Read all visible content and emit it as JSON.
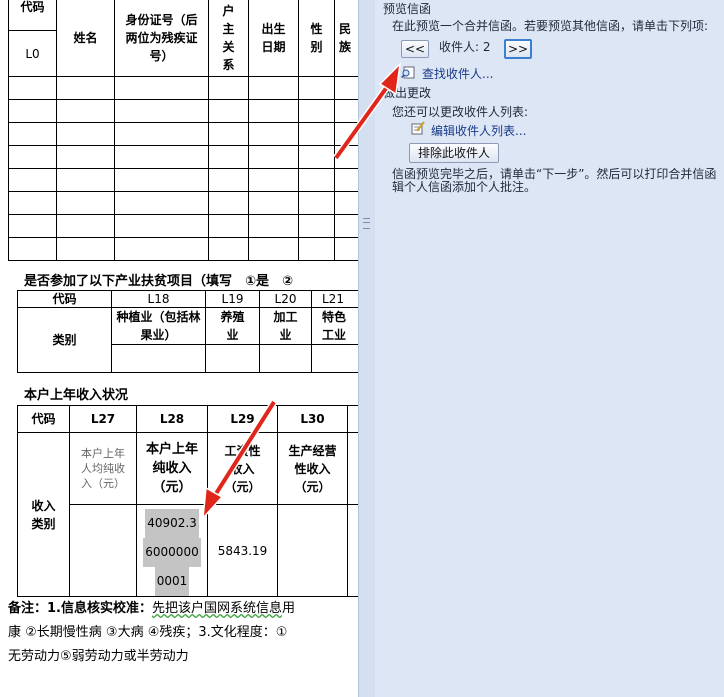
{
  "table1": {
    "headers": {
      "code": "代码",
      "name": "姓名",
      "id": "身份证号（后两位为残疾证号）",
      "relation": "户主关系",
      "birth": "出生日期",
      "gender": "性别",
      "ethnic": "民族"
    },
    "row_code": "L0"
  },
  "section2": {
    "title": "是否参加了以下产业扶贫项目（填写　①是　②",
    "code_label": "代码",
    "category_label": "类别",
    "cols": [
      "L18",
      "L19",
      "L20",
      "L21"
    ],
    "types": [
      "种植业（包括林果业）",
      "养殖业",
      "加工业",
      "特色工业"
    ]
  },
  "section3": {
    "title": "本户上年收入状况",
    "code_label": "代码",
    "category_label": "收入类别",
    "cols": [
      "L27",
      "L28",
      "L29",
      "L30"
    ],
    "headers": [
      "本户上年人均纯收入（元）",
      "本户上年纯收入（元）",
      "工资性收入（元）",
      "生产经营性收入（元）"
    ],
    "values": [
      "",
      "40902.36000000001",
      "5843.19",
      ""
    ],
    "val_lines": [
      "40902.3",
      "6000000",
      "0001"
    ]
  },
  "note": {
    "line1_a": "备注：1.信息核实校准：",
    "line1_b": "先把该户国网系统信息",
    "line1_c": "用",
    "line2": "康 ②长期慢性病 ③大病 ④残疾；3.文化程度：①",
    "line3": "无劳动力⑤弱劳动力或半劳动力"
  },
  "pane": {
    "preview_header": "预览信函",
    "preview_desc": "在此预览一个合并信函。若要预览其他信函，请单击下列项:",
    "prev_btn": "<<",
    "recipient_label": "收件人: 2",
    "next_btn": ">>",
    "find_recipient": "查找收件人...",
    "change_header": "做出更改",
    "change_desc": "您还可以更改收件人列表:",
    "edit_list": "编辑收件人列表...",
    "exclude_btn": "排除此收件人",
    "finish_line1": "信函预览完毕之后，请单击“下一步”。然后可以打印合并信函",
    "finish_line2": "辑个人信函添加个人批注。"
  },
  "colors": {
    "pane_bg": "#dce6f4",
    "arrow": "#e0251b",
    "highlight": "#c4c4c4",
    "link": "#1a3a8a"
  }
}
